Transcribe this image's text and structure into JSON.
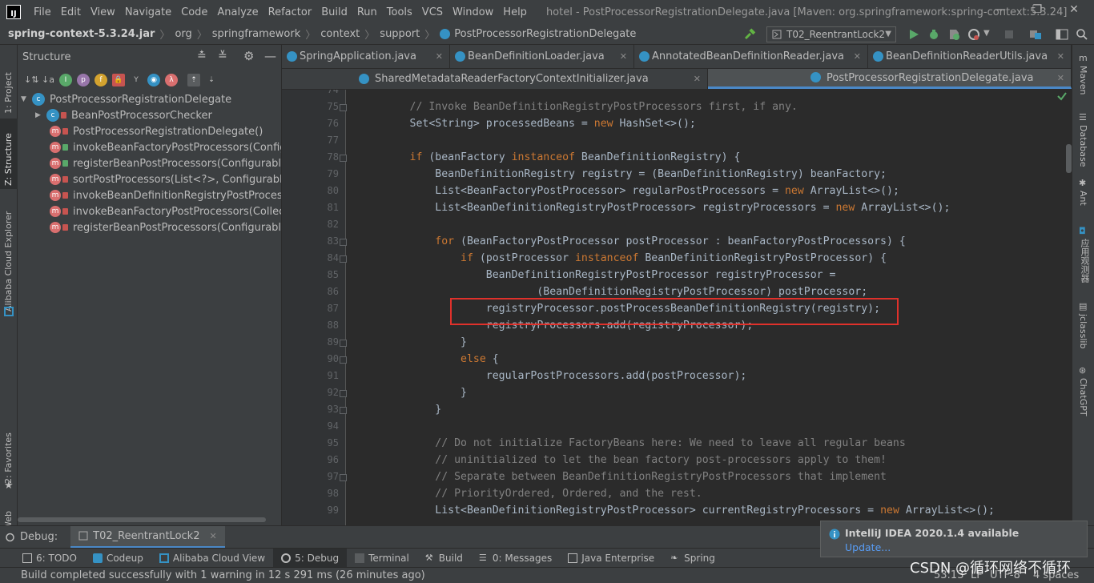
{
  "menubar": {
    "logo": "IJ",
    "items": [
      "File",
      "Edit",
      "View",
      "Navigate",
      "Code",
      "Analyze",
      "Refactor",
      "Build",
      "Run",
      "Tools",
      "VCS",
      "Window",
      "Help"
    ],
    "window_title": "hotel - PostProcessorRegistrationDelegate.java [Maven: org.springframework:spring-context:5.3.24]",
    "minimize": "—",
    "restore": "❐",
    "close": "✕"
  },
  "navbar": {
    "crumbs": [
      "spring-context-5.3.24.jar",
      "org",
      "springframework",
      "context",
      "support",
      "PostProcessorRegistrationDelegate"
    ],
    "run_config": "T02_ReentrantLock2"
  },
  "left_stripe": {
    "project": "1: Project",
    "structure": "Z: Structure",
    "alibaba": "Alibaba Cloud Explorer",
    "favorites": "2: Favorites",
    "web": "Web"
  },
  "structure": {
    "title": "Structure",
    "root": "PostProcessorRegistrationDelegate",
    "items": [
      "BeanPostProcessorChecker",
      "PostProcessorRegistrationDelegate()",
      "invokeBeanFactoryPostProcessors(Configura",
      "registerBeanPostProcessors(ConfigurableLis",
      "sortPostProcessors(List<?>, ConfigurableLis",
      "invokeBeanDefinitionRegistryPostProcessors",
      "invokeBeanFactoryPostProcessors(Collection",
      "registerBeanPostProcessors(ConfigurableLis"
    ]
  },
  "tabs_row1": [
    "SpringApplication.java",
    "BeanDefinitionLoader.java",
    "AnnotatedBeanDefinitionReader.java",
    "BeanDefinitionReaderUtils.java"
  ],
  "tabs_row2": [
    "SharedMetadataReaderFactoryContextInitializer.java",
    "PostProcessorRegistrationDelegate.java"
  ],
  "editor": {
    "line_numbers": [
      "74",
      "75",
      "76",
      "77",
      "78",
      "79",
      "80",
      "81",
      "82",
      "83",
      "84",
      "85",
      "86",
      "87",
      "88",
      "89",
      "90",
      "91",
      "92",
      "93",
      "94",
      "95",
      "96",
      "97",
      "98",
      "99"
    ],
    "lines": [
      {
        "indent": "",
        "parts": []
      },
      {
        "indent": "",
        "parts": [
          [
            "cm",
            "// Invoke BeanDefinitionRegistryPostProcessors first, if any."
          ]
        ]
      },
      {
        "indent": "",
        "parts": [
          [
            "",
            "Set<String> processedBeans = "
          ],
          [
            "kw",
            "new"
          ],
          [
            "",
            " HashSet<>();"
          ]
        ]
      },
      {
        "indent": "",
        "parts": []
      },
      {
        "indent": "",
        "parts": [
          [
            "kw",
            "if"
          ],
          [
            "",
            " (beanFactory "
          ],
          [
            "kw",
            "instanceof"
          ],
          [
            "",
            " BeanDefinitionRegistry) {"
          ]
        ]
      },
      {
        "indent": "    ",
        "parts": [
          [
            "",
            "BeanDefinitionRegistry registry = (BeanDefinitionRegistry) beanFactory;"
          ]
        ]
      },
      {
        "indent": "    ",
        "parts": [
          [
            "",
            "List<BeanFactoryPostProcessor> regularPostProcessors = "
          ],
          [
            "kw",
            "new"
          ],
          [
            "",
            " ArrayList<>();"
          ]
        ]
      },
      {
        "indent": "    ",
        "parts": [
          [
            "",
            "List<BeanDefinitionRegistryPostProcessor> registryProcessors = "
          ],
          [
            "kw",
            "new"
          ],
          [
            "",
            " ArrayList<>();"
          ]
        ]
      },
      {
        "indent": "",
        "parts": []
      },
      {
        "indent": "    ",
        "parts": [
          [
            "kw",
            "for"
          ],
          [
            "",
            " (BeanFactoryPostProcessor postProcessor : beanFactoryPostProcessors) {"
          ]
        ]
      },
      {
        "indent": "        ",
        "parts": [
          [
            "kw",
            "if"
          ],
          [
            "",
            " (postProcessor "
          ],
          [
            "kw",
            "instanceof"
          ],
          [
            "",
            " BeanDefinitionRegistryPostProcessor) {"
          ]
        ]
      },
      {
        "indent": "            ",
        "parts": [
          [
            "",
            "BeanDefinitionRegistryPostProcessor registryProcessor ="
          ]
        ]
      },
      {
        "indent": "                    ",
        "parts": [
          [
            "",
            "(BeanDefinitionRegistryPostProcessor) postProcessor;"
          ]
        ]
      },
      {
        "indent": "            ",
        "parts": [
          [
            "",
            "registryProcessor.postProcessBeanDefinitionRegistry(registry);"
          ]
        ]
      },
      {
        "indent": "            ",
        "parts": [
          [
            "",
            "registryProcessors.add(registryProcessor);"
          ]
        ]
      },
      {
        "indent": "        ",
        "parts": [
          [
            "",
            "}"
          ]
        ]
      },
      {
        "indent": "        ",
        "parts": [
          [
            "kw",
            "else"
          ],
          [
            "",
            " {"
          ]
        ]
      },
      {
        "indent": "            ",
        "parts": [
          [
            "",
            "regularPostProcessors.add(postProcessor);"
          ]
        ]
      },
      {
        "indent": "        ",
        "parts": [
          [
            "",
            "}"
          ]
        ]
      },
      {
        "indent": "    ",
        "parts": [
          [
            "",
            "}"
          ]
        ]
      },
      {
        "indent": "",
        "parts": []
      },
      {
        "indent": "    ",
        "parts": [
          [
            "cm",
            "// Do not initialize FactoryBeans here: We need to leave all regular beans"
          ]
        ]
      },
      {
        "indent": "    ",
        "parts": [
          [
            "cm",
            "// uninitialized to let the bean factory post-processors apply to them!"
          ]
        ]
      },
      {
        "indent": "    ",
        "parts": [
          [
            "cm",
            "// Separate between BeanDefinitionRegistryPostProcessors that implement"
          ]
        ]
      },
      {
        "indent": "    ",
        "parts": [
          [
            "cm",
            "// PriorityOrdered, Ordered, and the rest."
          ]
        ]
      },
      {
        "indent": "    ",
        "parts": [
          [
            "",
            "List<BeanDefinitionRegistryPostProcessor> currentRegistryProcessors = "
          ],
          [
            "kw",
            "new"
          ],
          [
            "",
            " ArrayList<>();"
          ]
        ]
      }
    ]
  },
  "right_stripe": {
    "maven": "Maven",
    "database": "Database",
    "ant": "Ant",
    "app_observe": "应用观测器",
    "jclasslib": "jclasslib",
    "chatgpt": "ChatGPT"
  },
  "debug": {
    "label": "Debug:",
    "session": "T02_ReentrantLock2"
  },
  "toolwindows": [
    "6: TODO",
    "Codeup",
    "Alibaba Cloud View",
    "5: Debug",
    "Terminal",
    "Build",
    "0: Messages",
    "Java Enterprise",
    "Spring"
  ],
  "status": {
    "message": "Build completed successfully with 1 warning in 12 s 291 ms (26 minutes ago)",
    "position": "53:13",
    "line_sep": "LF",
    "encoding": "UTF-8",
    "indent": "4 spaces"
  },
  "notification": {
    "title": "IntelliJ IDEA 2020.1.4 available",
    "link": "Update..."
  },
  "watermark": "CSDN @循环网络不循环",
  "colors": {
    "keyword": "#cc7832",
    "comment": "#808080",
    "highlight_box": "#e0312b",
    "editor_bg": "#2b2b2b"
  }
}
